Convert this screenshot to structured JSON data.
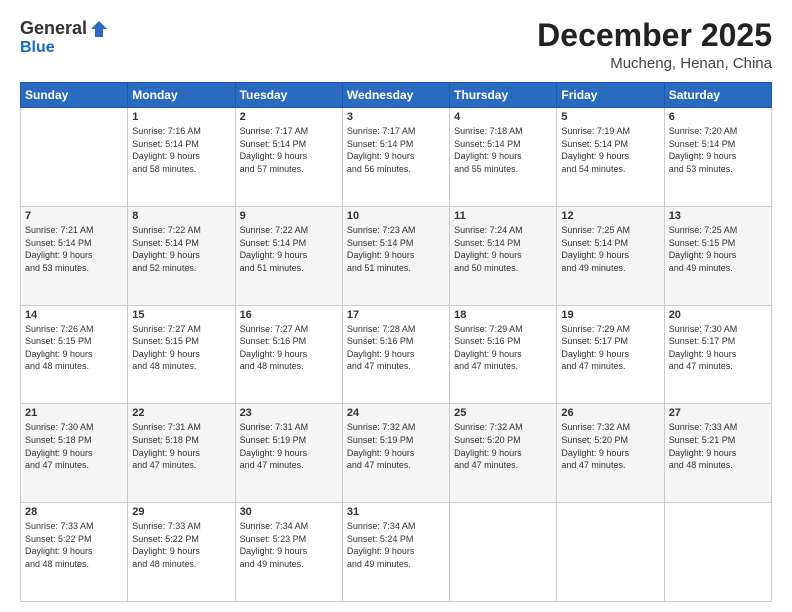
{
  "logo": {
    "general": "General",
    "blue": "Blue"
  },
  "title": "December 2025",
  "location": "Mucheng, Henan, China",
  "days_header": [
    "Sunday",
    "Monday",
    "Tuesday",
    "Wednesday",
    "Thursday",
    "Friday",
    "Saturday"
  ],
  "weeks": [
    [
      {
        "day": "",
        "info": ""
      },
      {
        "day": "1",
        "info": "Sunrise: 7:16 AM\nSunset: 5:14 PM\nDaylight: 9 hours\nand 58 minutes."
      },
      {
        "day": "2",
        "info": "Sunrise: 7:17 AM\nSunset: 5:14 PM\nDaylight: 9 hours\nand 57 minutes."
      },
      {
        "day": "3",
        "info": "Sunrise: 7:17 AM\nSunset: 5:14 PM\nDaylight: 9 hours\nand 56 minutes."
      },
      {
        "day": "4",
        "info": "Sunrise: 7:18 AM\nSunset: 5:14 PM\nDaylight: 9 hours\nand 55 minutes."
      },
      {
        "day": "5",
        "info": "Sunrise: 7:19 AM\nSunset: 5:14 PM\nDaylight: 9 hours\nand 54 minutes."
      },
      {
        "day": "6",
        "info": "Sunrise: 7:20 AM\nSunset: 5:14 PM\nDaylight: 9 hours\nand 53 minutes."
      }
    ],
    [
      {
        "day": "7",
        "info": "Sunrise: 7:21 AM\nSunset: 5:14 PM\nDaylight: 9 hours\nand 53 minutes."
      },
      {
        "day": "8",
        "info": "Sunrise: 7:22 AM\nSunset: 5:14 PM\nDaylight: 9 hours\nand 52 minutes."
      },
      {
        "day": "9",
        "info": "Sunrise: 7:22 AM\nSunset: 5:14 PM\nDaylight: 9 hours\nand 51 minutes."
      },
      {
        "day": "10",
        "info": "Sunrise: 7:23 AM\nSunset: 5:14 PM\nDaylight: 9 hours\nand 51 minutes."
      },
      {
        "day": "11",
        "info": "Sunrise: 7:24 AM\nSunset: 5:14 PM\nDaylight: 9 hours\nand 50 minutes."
      },
      {
        "day": "12",
        "info": "Sunrise: 7:25 AM\nSunset: 5:14 PM\nDaylight: 9 hours\nand 49 minutes."
      },
      {
        "day": "13",
        "info": "Sunrise: 7:25 AM\nSunset: 5:15 PM\nDaylight: 9 hours\nand 49 minutes."
      }
    ],
    [
      {
        "day": "14",
        "info": "Sunrise: 7:26 AM\nSunset: 5:15 PM\nDaylight: 9 hours\nand 48 minutes."
      },
      {
        "day": "15",
        "info": "Sunrise: 7:27 AM\nSunset: 5:15 PM\nDaylight: 9 hours\nand 48 minutes."
      },
      {
        "day": "16",
        "info": "Sunrise: 7:27 AM\nSunset: 5:16 PM\nDaylight: 9 hours\nand 48 minutes."
      },
      {
        "day": "17",
        "info": "Sunrise: 7:28 AM\nSunset: 5:16 PM\nDaylight: 9 hours\nand 47 minutes."
      },
      {
        "day": "18",
        "info": "Sunrise: 7:29 AM\nSunset: 5:16 PM\nDaylight: 9 hours\nand 47 minutes."
      },
      {
        "day": "19",
        "info": "Sunrise: 7:29 AM\nSunset: 5:17 PM\nDaylight: 9 hours\nand 47 minutes."
      },
      {
        "day": "20",
        "info": "Sunrise: 7:30 AM\nSunset: 5:17 PM\nDaylight: 9 hours\nand 47 minutes."
      }
    ],
    [
      {
        "day": "21",
        "info": "Sunrise: 7:30 AM\nSunset: 5:18 PM\nDaylight: 9 hours\nand 47 minutes."
      },
      {
        "day": "22",
        "info": "Sunrise: 7:31 AM\nSunset: 5:18 PM\nDaylight: 9 hours\nand 47 minutes."
      },
      {
        "day": "23",
        "info": "Sunrise: 7:31 AM\nSunset: 5:19 PM\nDaylight: 9 hours\nand 47 minutes."
      },
      {
        "day": "24",
        "info": "Sunrise: 7:32 AM\nSunset: 5:19 PM\nDaylight: 9 hours\nand 47 minutes."
      },
      {
        "day": "25",
        "info": "Sunrise: 7:32 AM\nSunset: 5:20 PM\nDaylight: 9 hours\nand 47 minutes."
      },
      {
        "day": "26",
        "info": "Sunrise: 7:32 AM\nSunset: 5:20 PM\nDaylight: 9 hours\nand 47 minutes."
      },
      {
        "day": "27",
        "info": "Sunrise: 7:33 AM\nSunset: 5:21 PM\nDaylight: 9 hours\nand 48 minutes."
      }
    ],
    [
      {
        "day": "28",
        "info": "Sunrise: 7:33 AM\nSunset: 5:22 PM\nDaylight: 9 hours\nand 48 minutes."
      },
      {
        "day": "29",
        "info": "Sunrise: 7:33 AM\nSunset: 5:22 PM\nDaylight: 9 hours\nand 48 minutes."
      },
      {
        "day": "30",
        "info": "Sunrise: 7:34 AM\nSunset: 5:23 PM\nDaylight: 9 hours\nand 49 minutes."
      },
      {
        "day": "31",
        "info": "Sunrise: 7:34 AM\nSunset: 5:24 PM\nDaylight: 9 hours\nand 49 minutes."
      },
      {
        "day": "",
        "info": ""
      },
      {
        "day": "",
        "info": ""
      },
      {
        "day": "",
        "info": ""
      }
    ]
  ]
}
